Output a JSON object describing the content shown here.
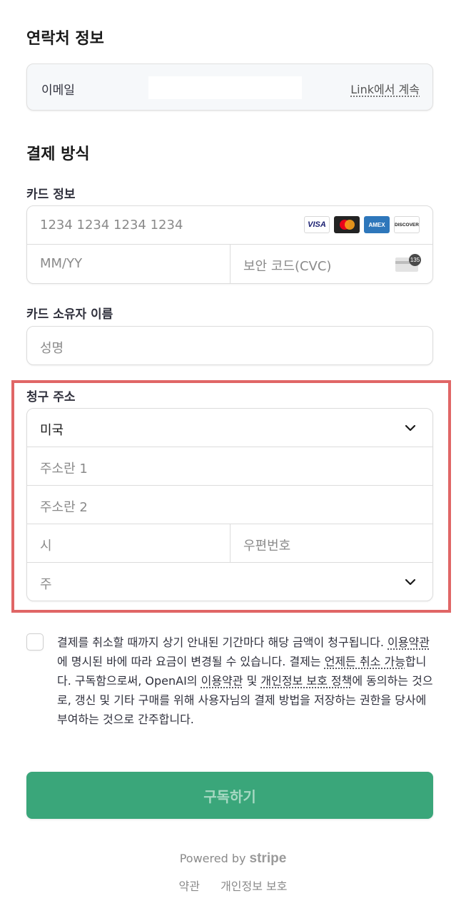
{
  "contact": {
    "heading": "연락처 정보",
    "email_label": "이메일",
    "email_value": "",
    "link_continue": "Link에서 계속"
  },
  "payment": {
    "heading": "결제 방식",
    "card_label": "카드 정보",
    "card_number_placeholder": "1234 1234 1234 1234",
    "expiry_placeholder": "MM/YY",
    "cvc_placeholder": "보안 코드(CVC)",
    "cvc_icon_number": "135",
    "brands": {
      "visa": "VISA",
      "amex": "AMEX",
      "discover": "DISCOVER"
    },
    "holder_label": "카드 소유자 이름",
    "holder_placeholder": "성명"
  },
  "billing": {
    "heading": "청구 주소",
    "country_value": "미국",
    "address1_placeholder": "주소란 1",
    "address2_placeholder": "주소란 2",
    "city_placeholder": "시",
    "zip_placeholder": "우편번호",
    "state_placeholder": "주"
  },
  "consent": {
    "part1": "결제를 취소할 때까지 상기 안내된 기간마다 해당 금액이 청구됩니다. ",
    "terms_link": "이용약관",
    "part2": "에 명시된 바에 따라 요금이 변경될 수 있습니다. 결제는 ",
    "cancel_link": "언제든 취소 가능",
    "part3": "합니다. 구독함으로써, OpenAI의 ",
    "terms_link2": "이용약관",
    "part4": " 및 ",
    "privacy_link": "개인정보 보호 정책",
    "part5": "에 동의하는 것으로, 갱신 및 기타 구매를 위해 사용자님의 결제 방법을 저장하는 권한을 당사에 부여하는 것으로 간주합니다."
  },
  "subscribe_label": "구독하기",
  "footer": {
    "powered_by": "Powered by",
    "stripe": "stripe",
    "terms": "약관",
    "privacy": "개인정보 보호"
  },
  "colors": {
    "accent": "#3aa67a",
    "highlight": "#e06666"
  }
}
